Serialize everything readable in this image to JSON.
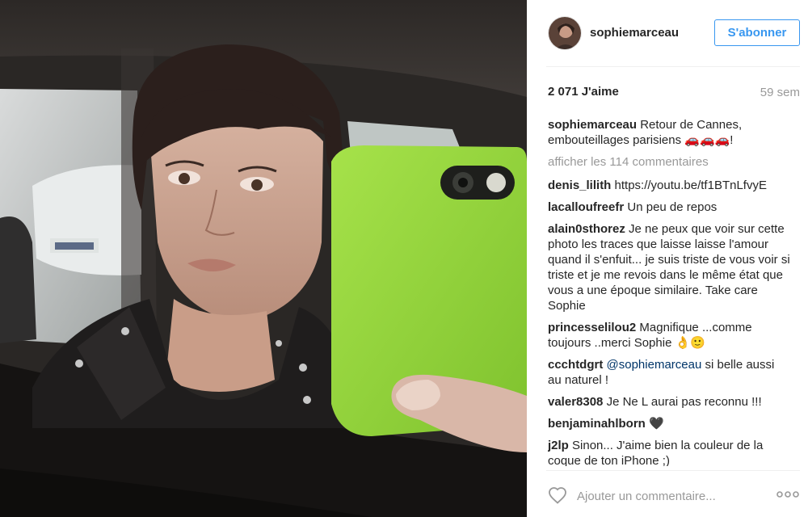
{
  "post": {
    "author": "sophiemarceau",
    "follow_label": "S'abonner",
    "likes": "2 071 J'aime",
    "time": "59 sem",
    "caption": {
      "user": "sophiemarceau",
      "text": "Retour de Cannes, embouteillages parisiens 🚗🚗🚗!"
    },
    "load_more": "afficher les 114 commentaires",
    "comments": [
      {
        "user": "denis_lilith",
        "text": "https://youtu.be/tf1BTnLfvyE"
      },
      {
        "user": "lacalloufreefr",
        "text": "Un peu de repos"
      },
      {
        "user": "alain0sthorez",
        "text": "Je ne peux que voir sur cette photo les traces que laisse laisse l'amour quand il s'enfuit... je suis triste de vous voir si triste et je me revois dans le même état que vous a une époque similaire. Take care Sophie"
      },
      {
        "user": "princesselilou2",
        "text": "Magnifique ...comme toujours ..merci Sophie 👌🙂"
      },
      {
        "user": "ccchtdgrt",
        "mention": "@sophiemarceau",
        "text": " si belle aussi au naturel !"
      },
      {
        "user": "valer8308",
        "text": "Je Ne L aurai pas reconnu !!!"
      },
      {
        "user": "benjaminahlborn",
        "text": "🖤"
      },
      {
        "user": "j2lp",
        "text": "Sinon... J'aime bien la couleur de la coque de ton iPhone ;)"
      }
    ],
    "comment_placeholder": "Ajouter un commentaire..."
  },
  "icons": {
    "like": "heart-icon",
    "more": "more-options-icon"
  },
  "colors": {
    "accent": "#3897f0",
    "muted": "#999999",
    "text": "#262626",
    "phone_case": "#8fd33a"
  }
}
